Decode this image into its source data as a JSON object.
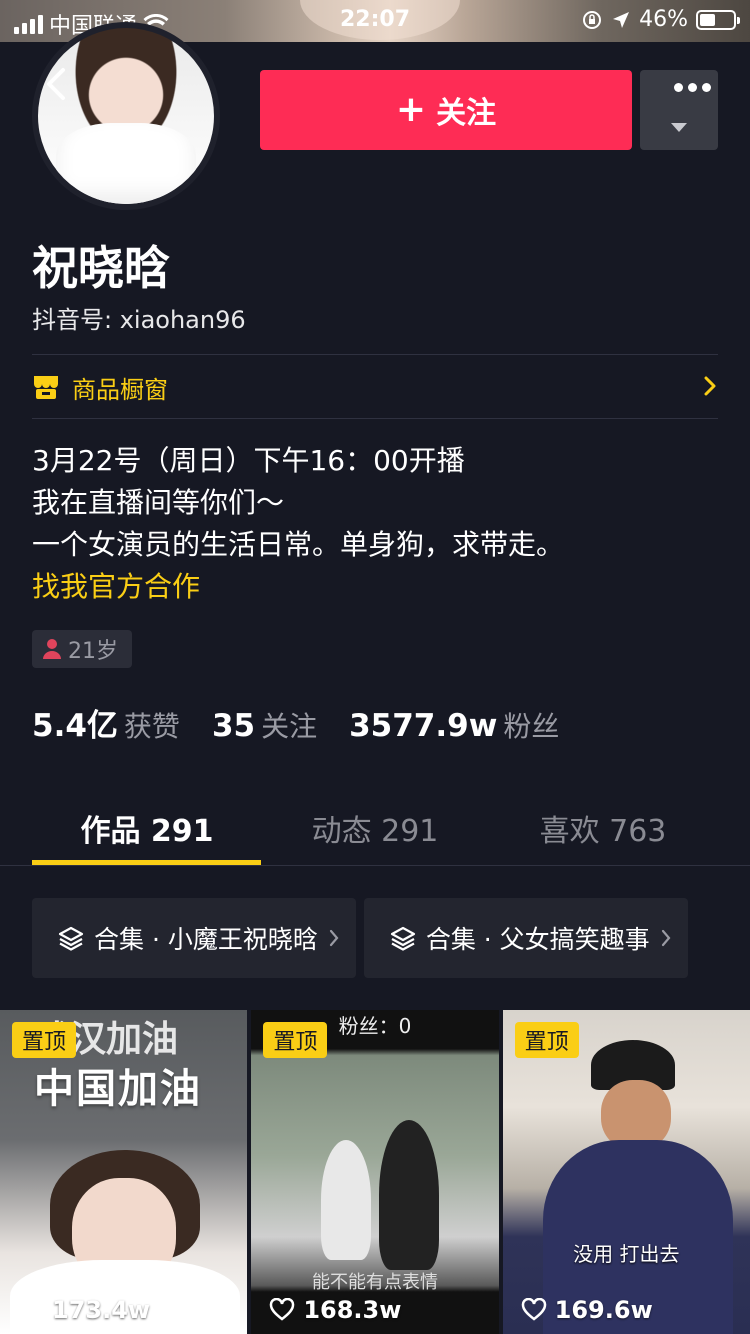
{
  "status_bar": {
    "carrier": "中国联通",
    "time": "22:07",
    "battery": "46%"
  },
  "header": {
    "follow_label": "关注",
    "follow_plus": "+"
  },
  "profile": {
    "name": "祝晓晗",
    "douyin_id": "抖音号: xiaohan96",
    "shop_label": "商品橱窗",
    "bio_lines": [
      "3月22号（周日）下午16：00开播",
      "我在直播间等你们～",
      "一个女演员的生活日常。单身狗，求带走。"
    ],
    "bio_link": "找我官方合作",
    "age": "21岁"
  },
  "stats": [
    {
      "value": "5.4亿",
      "label": "获赞"
    },
    {
      "value": "35",
      "label": "关注"
    },
    {
      "value": "3577.9w",
      "label": "粉丝"
    }
  ],
  "tabs": [
    {
      "label": "作品 291",
      "active": true
    },
    {
      "label": "动态 291",
      "active": false
    },
    {
      "label": "喜欢 763",
      "active": false
    }
  ],
  "collections": [
    {
      "label": "合集 · 小魔王祝晓晗"
    },
    {
      "label": "合集 · 父女搞笑趣事"
    }
  ],
  "videos": [
    {
      "pinned_label": "置顶",
      "likes": "173.4w",
      "overlay_line1": "武汉加油",
      "overlay_line2": "中国加油"
    },
    {
      "pinned_label": "置顶",
      "likes": "168.3w",
      "caption_top": "粉丝：0",
      "caption_bottom": "能不能有点表情"
    },
    {
      "pinned_label": "置顶",
      "likes": "169.6w",
      "caption_mid": "没用 打出去"
    }
  ],
  "colors": {
    "background": "#161823",
    "follow_button": "#fe2c55",
    "accent_yellow": "#face15",
    "muted_text": "#9a9ba4"
  }
}
